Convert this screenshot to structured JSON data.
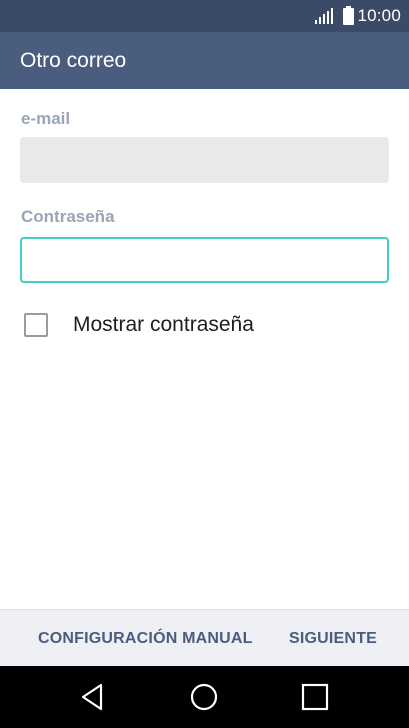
{
  "status_bar": {
    "time": "10:00"
  },
  "app_bar": {
    "title": "Otro correo"
  },
  "form": {
    "email": {
      "label": "e-mail",
      "value": "",
      "placeholder": ""
    },
    "password": {
      "label": "Contraseña",
      "value": "",
      "placeholder": ""
    },
    "show_password": {
      "label": "Mostrar contraseña",
      "checked": false
    }
  },
  "actions": {
    "manual_config": "CONFIGURACIÓN MANUAL",
    "next": "SIGUIENTE"
  },
  "colors": {
    "status_bar": "#3b4a66",
    "app_bar": "#4b5d7e",
    "accent": "#40cfc0",
    "label": "#9aa6b6"
  },
  "icons": {
    "signal": "signal-icon",
    "battery": "battery-icon",
    "back": "back-triangle-icon",
    "home": "home-circle-icon",
    "recent": "recent-square-icon"
  }
}
